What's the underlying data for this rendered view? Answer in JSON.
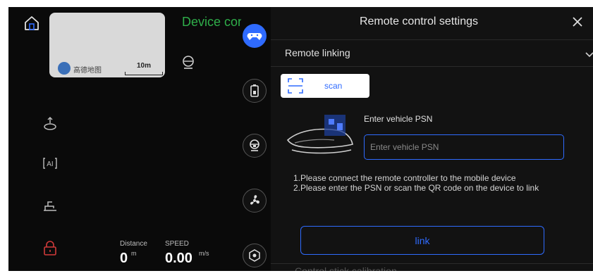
{
  "left": {
    "device_title": "Device control",
    "map": {
      "provider": "高德地图",
      "scale": "10m"
    },
    "metrics": {
      "distance_label": "Distance",
      "distance_value": "0",
      "distance_unit": "m",
      "speed_label": "SPEED",
      "speed_value": "0.00",
      "speed_unit": "m/s"
    }
  },
  "tools": [
    "gamepad-icon",
    "battery-icon",
    "camera-icon",
    "fan-icon",
    "sensor-icon"
  ],
  "settings": {
    "title": "Remote control settings",
    "section": "Remote linking",
    "scan_label": "scan",
    "psn_label": "Enter vehicle PSN",
    "psn_placeholder": "Enter vehicle PSN",
    "psn_value": "",
    "instruction_1": "1.Please connect the remote controller to the mobile device",
    "instruction_2": "2.Please enter the PSN or scan the QR code on the device to link",
    "link_label": "link",
    "next_section": "Control stick calibration"
  },
  "colors": {
    "accent": "#2f6bff",
    "green": "#2fae4a",
    "lock": "#d13a3a",
    "panel": "#121212"
  }
}
